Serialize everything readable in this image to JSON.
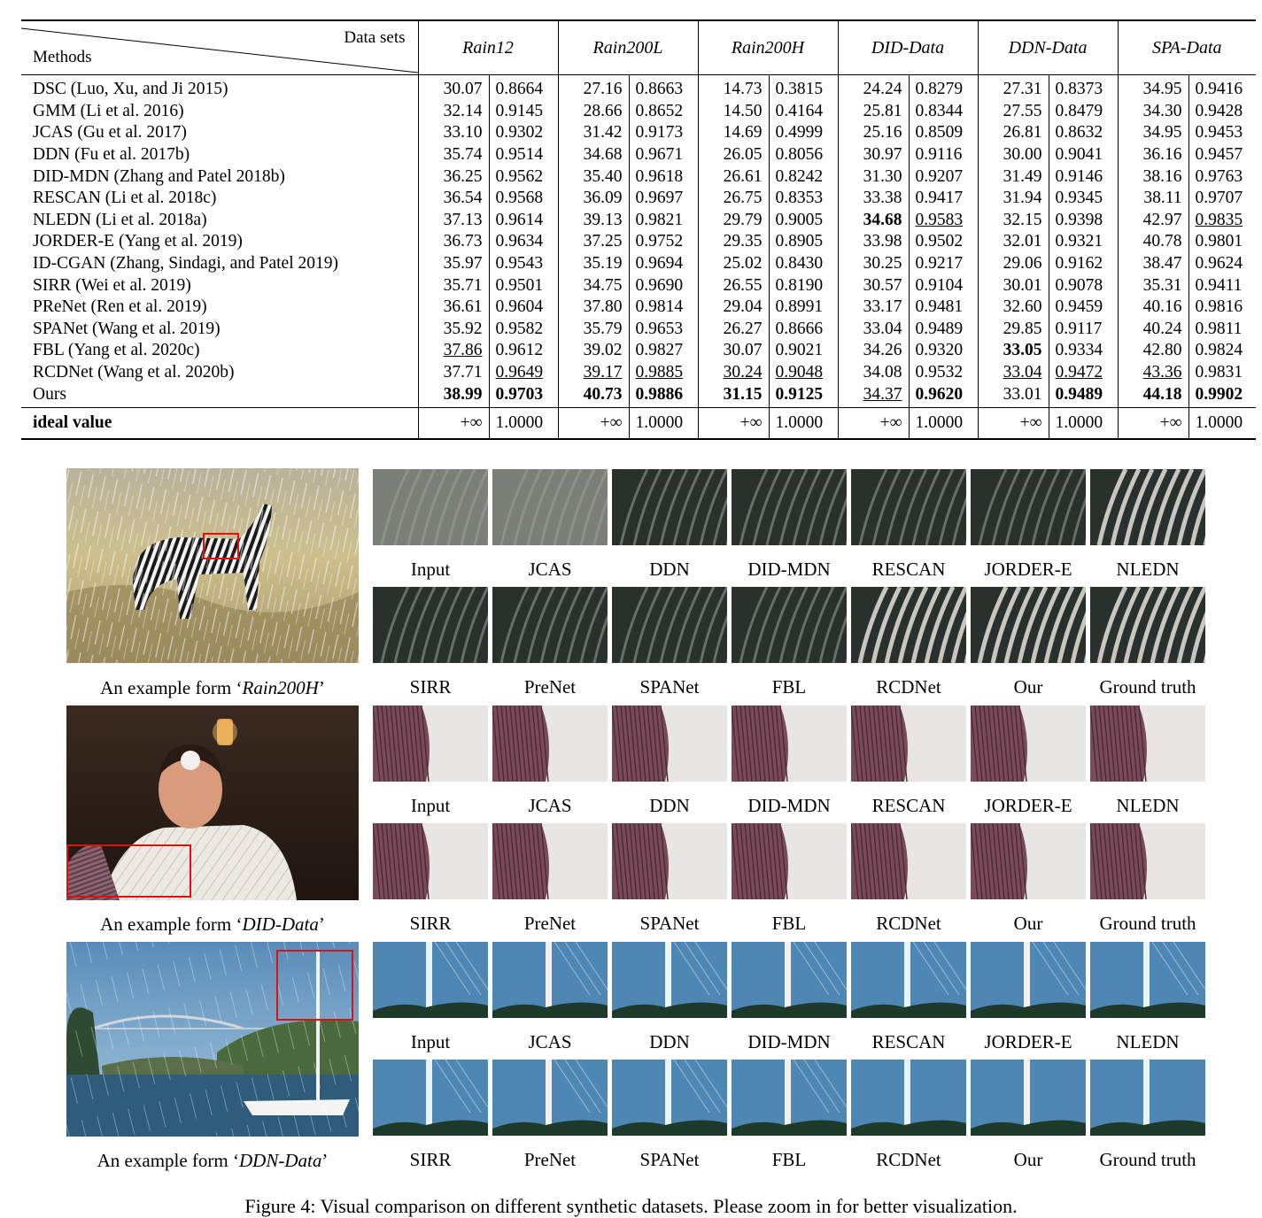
{
  "table": {
    "header_datasets_label": "Data sets",
    "header_methods_label": "Methods",
    "datasets": [
      "Rain12",
      "Rain200L",
      "Rain200H",
      "DID-Data",
      "DDN-Data",
      "SPA-Data"
    ],
    "rows": [
      {
        "method": "DSC (Luo, Xu, and Ji 2015)",
        "cells": [
          [
            "30.07",
            "0.8664"
          ],
          [
            "27.16",
            "0.8663"
          ],
          [
            "14.73",
            "0.3815"
          ],
          [
            "24.24",
            "0.8279"
          ],
          [
            "27.31",
            "0.8373"
          ],
          [
            "34.95",
            "0.9416"
          ]
        ]
      },
      {
        "method": "GMM (Li et al. 2016)",
        "cells": [
          [
            "32.14",
            "0.9145"
          ],
          [
            "28.66",
            "0.8652"
          ],
          [
            "14.50",
            "0.4164"
          ],
          [
            "25.81",
            "0.8344"
          ],
          [
            "27.55",
            "0.8479"
          ],
          [
            "34.30",
            "0.9428"
          ]
        ]
      },
      {
        "method": "JCAS (Gu et al. 2017)",
        "cells": [
          [
            "33.10",
            "0.9302"
          ],
          [
            "31.42",
            "0.9173"
          ],
          [
            "14.69",
            "0.4999"
          ],
          [
            "25.16",
            "0.8509"
          ],
          [
            "26.81",
            "0.8632"
          ],
          [
            "34.95",
            "0.9453"
          ]
        ]
      },
      {
        "method": "DDN (Fu et al. 2017b)",
        "cells": [
          [
            "35.74",
            "0.9514"
          ],
          [
            "34.68",
            "0.9671"
          ],
          [
            "26.05",
            "0.8056"
          ],
          [
            "30.97",
            "0.9116"
          ],
          [
            "30.00",
            "0.9041"
          ],
          [
            "36.16",
            "0.9457"
          ]
        ]
      },
      {
        "method": "DID-MDN (Zhang and Patel 2018b)",
        "cells": [
          [
            "36.25",
            "0.9562"
          ],
          [
            "35.40",
            "0.9618"
          ],
          [
            "26.61",
            "0.8242"
          ],
          [
            "31.30",
            "0.9207"
          ],
          [
            "31.49",
            "0.9146"
          ],
          [
            "38.16",
            "0.9763"
          ]
        ]
      },
      {
        "method": "RESCAN (Li et al. 2018c)",
        "cells": [
          [
            "36.54",
            "0.9568"
          ],
          [
            "36.09",
            "0.9697"
          ],
          [
            "26.75",
            "0.8353"
          ],
          [
            "33.38",
            "0.9417"
          ],
          [
            "31.94",
            "0.9345"
          ],
          [
            "38.11",
            "0.9707"
          ]
        ]
      },
      {
        "method": "NLEDN (Li et al. 2018a)",
        "cells": [
          [
            "37.13",
            "0.9614"
          ],
          [
            "39.13",
            "0.9821"
          ],
          [
            "29.79",
            "0.9005"
          ],
          [
            "34.68",
            "0.9583"
          ],
          [
            "32.15",
            "0.9398"
          ],
          [
            "42.97",
            "0.9835"
          ]
        ]
      },
      {
        "method": "JORDER-E (Yang et al. 2019)",
        "cells": [
          [
            "36.73",
            "0.9634"
          ],
          [
            "37.25",
            "0.9752"
          ],
          [
            "29.35",
            "0.8905"
          ],
          [
            "33.98",
            "0.9502"
          ],
          [
            "32.01",
            "0.9321"
          ],
          [
            "40.78",
            "0.9801"
          ]
        ]
      },
      {
        "method": "ID-CGAN (Zhang, Sindagi, and Patel 2019)",
        "cells": [
          [
            "35.97",
            "0.9543"
          ],
          [
            "35.19",
            "0.9694"
          ],
          [
            "25.02",
            "0.8430"
          ],
          [
            "30.25",
            "0.9217"
          ],
          [
            "29.06",
            "0.9162"
          ],
          [
            "38.47",
            "0.9624"
          ]
        ]
      },
      {
        "method": "SIRR (Wei et al. 2019)",
        "cells": [
          [
            "35.71",
            "0.9501"
          ],
          [
            "34.75",
            "0.9690"
          ],
          [
            "26.55",
            "0.8190"
          ],
          [
            "30.57",
            "0.9104"
          ],
          [
            "30.01",
            "0.9078"
          ],
          [
            "35.31",
            "0.9411"
          ]
        ]
      },
      {
        "method": "PReNet (Ren et al. 2019)",
        "cells": [
          [
            "36.61",
            "0.9604"
          ],
          [
            "37.80",
            "0.9814"
          ],
          [
            "29.04",
            "0.8991"
          ],
          [
            "33.17",
            "0.9481"
          ],
          [
            "32.60",
            "0.9459"
          ],
          [
            "40.16",
            "0.9816"
          ]
        ]
      },
      {
        "method": "SPANet (Wang et al. 2019)",
        "cells": [
          [
            "35.92",
            "0.9582"
          ],
          [
            "35.79",
            "0.9653"
          ],
          [
            "26.27",
            "0.8666"
          ],
          [
            "33.04",
            "0.9489"
          ],
          [
            "29.85",
            "0.9117"
          ],
          [
            "40.24",
            "0.9811"
          ]
        ]
      },
      {
        "method": "FBL (Yang et al. 2020c)",
        "cells": [
          [
            "37.86",
            "0.9612"
          ],
          [
            "39.02",
            "0.9827"
          ],
          [
            "30.07",
            "0.9021"
          ],
          [
            "34.26",
            "0.9320"
          ],
          [
            "33.05",
            "0.9334"
          ],
          [
            "42.80",
            "0.9824"
          ]
        ]
      },
      {
        "method": "RCDNet (Wang et al. 2020b)",
        "cells": [
          [
            "37.71",
            "0.9649"
          ],
          [
            "39.17",
            "0.9885"
          ],
          [
            "30.24",
            "0.9048"
          ],
          [
            "34.08",
            "0.9532"
          ],
          [
            "33.04",
            "0.9472"
          ],
          [
            "43.36",
            "0.9831"
          ]
        ]
      },
      {
        "method": "Ours",
        "cells": [
          [
            "38.99",
            "0.9703"
          ],
          [
            "40.73",
            "0.9886"
          ],
          [
            "31.15",
            "0.9125"
          ],
          [
            "34.37",
            "0.9620"
          ],
          [
            "33.01",
            "0.9489"
          ],
          [
            "44.18",
            "0.9902"
          ]
        ]
      }
    ],
    "ideal": {
      "label": "ideal value",
      "psnr": "+∞",
      "ssim": "1.0000"
    },
    "bold_cells": [
      [
        6,
        3,
        0
      ],
      [
        12,
        4,
        0
      ],
      [
        14,
        0,
        0
      ],
      [
        14,
        0,
        1
      ],
      [
        14,
        1,
        0
      ],
      [
        14,
        1,
        1
      ],
      [
        14,
        2,
        0
      ],
      [
        14,
        2,
        1
      ],
      [
        14,
        3,
        1
      ],
      [
        14,
        4,
        1
      ],
      [
        14,
        5,
        0
      ],
      [
        14,
        5,
        1
      ]
    ],
    "underline_cells": [
      [
        6,
        3,
        1
      ],
      [
        6,
        5,
        1
      ],
      [
        12,
        0,
        0
      ],
      [
        13,
        0,
        1
      ],
      [
        13,
        1,
        0
      ],
      [
        13,
        1,
        1
      ],
      [
        13,
        2,
        0
      ],
      [
        13,
        2,
        1
      ],
      [
        13,
        4,
        0
      ],
      [
        13,
        4,
        1
      ],
      [
        13,
        5,
        0
      ],
      [
        14,
        3,
        0
      ]
    ]
  },
  "figure": {
    "row1_labels": [
      "Input",
      "JCAS",
      "DDN",
      "DID-MDN",
      "RESCAN",
      "JORDER-E",
      "NLEDN"
    ],
    "row2_labels": [
      "SIRR",
      "PreNet",
      "SPANet",
      "FBL",
      "RCDNet",
      "Our",
      "Ground truth"
    ],
    "examples": [
      {
        "prefix": "An example form ‘",
        "dataset": "Rain200H",
        "suffix": "’"
      },
      {
        "prefix": "An example form ‘",
        "dataset": "DID-Data",
        "suffix": "’"
      },
      {
        "prefix": "An example form ‘",
        "dataset": "DDN-Data",
        "suffix": "’"
      }
    ]
  },
  "caption": "Figure 4: Visual comparison on different synthetic datasets. Please zoom in for better visualization."
}
